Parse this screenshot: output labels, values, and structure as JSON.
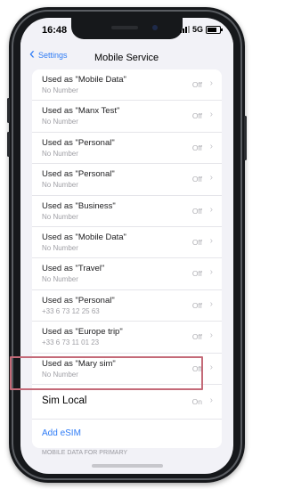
{
  "status_bar": {
    "time": "16:48",
    "network": "5G"
  },
  "nav": {
    "back_label": "Settings",
    "title": "Mobile Service"
  },
  "rows": [
    {
      "title": "Used as \"Mobile Data\"",
      "subtitle": "No Number",
      "status": "Off"
    },
    {
      "title": "Used as \"Manx  Test\"",
      "subtitle": "No Number",
      "status": "Off"
    },
    {
      "title": "Used as \"Personal\"",
      "subtitle": "No Number",
      "status": "Off"
    },
    {
      "title": "Used as \"Personal\"",
      "subtitle": "No Number",
      "status": "Off"
    },
    {
      "title": "Used as \"Business\"",
      "subtitle": "No Number",
      "status": "Off"
    },
    {
      "title": "Used as \"Mobile Data\"",
      "subtitle": "No Number",
      "status": "Off"
    },
    {
      "title": "Used as \"Travel\"",
      "subtitle": "No Number",
      "status": "Off"
    },
    {
      "title": "Used as \"Personal\"",
      "subtitle": "+33 6 73 12 25 63",
      "status": "Off"
    },
    {
      "title": "Used as \"Europe  trip\"",
      "subtitle": "+33 6 73 11 01 23",
      "status": "Off"
    },
    {
      "title": "Used as \"Mary sim\"",
      "subtitle": "No Number",
      "status": "Off"
    }
  ],
  "sim_local": {
    "title": "Sim Local",
    "status": "On"
  },
  "add_esim_label": "Add eSIM",
  "footer_label": "MOBILE DATA FOR PRIMARY",
  "colors": {
    "accent": "#2f7cf6",
    "highlight": "#c46a78"
  }
}
